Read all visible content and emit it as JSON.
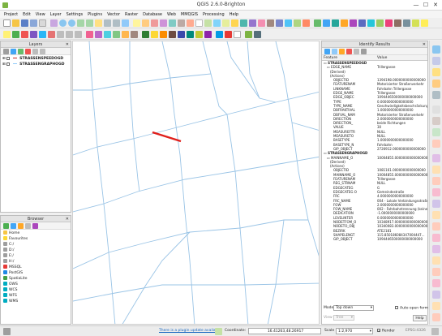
{
  "window": {
    "title": "QGIS 2.6.0-Brighton",
    "minimize": "—",
    "maximize": "☐",
    "close": "✕"
  },
  "menu": [
    "Project",
    "Edit",
    "View",
    "Layer",
    "Settings",
    "Plugins",
    "Vector",
    "Raster",
    "Database",
    "Web",
    "MMQGIS",
    "Processing",
    "Help"
  ],
  "layers": {
    "title": "Layers",
    "items": [
      {
        "label": "STRASSENSPEEDOGD",
        "color": "#c62828"
      },
      {
        "label": "STRASSENGRAPHOGD",
        "color": "#90caf9"
      }
    ]
  },
  "browser": {
    "title": "Browser",
    "items": [
      "Home",
      "Favourites",
      "C:/",
      "D:/",
      "E:/",
      "H:/",
      "MSSQL",
      "PostGIS",
      "SpatiaLite",
      "OWS",
      "WCS",
      "WFS",
      "WMS"
    ]
  },
  "identify": {
    "title": "Identify Results",
    "col_feature": "Feature",
    "col_value": "Value",
    "rows": [
      {
        "f": "▭ STRASSENSPEEDOGD",
        "v": "",
        "indent": 0
      },
      {
        "f": "▭ EDGE_NAME",
        "v": "Trillergasse",
        "indent": 1
      },
      {
        "f": "(Derived)",
        "v": "",
        "indent": 2
      },
      {
        "f": "(Actions)",
        "v": "",
        "indent": 2
      },
      {
        "f": "OBJECTID",
        "v": "1394198.0000000000000000",
        "indent": 3
      },
      {
        "f": "FEATURENAM",
        "v": "Motorisierter Straßenverkehr",
        "indent": 3
      },
      {
        "f": "LINKNAME",
        "v": "Fahrbahn Trillergasse",
        "indent": 3
      },
      {
        "f": "EDGE_NAME",
        "v": "Trillergasse",
        "indent": 3
      },
      {
        "f": "EDGE_OBJEC",
        "v": "1094446500000000000000",
        "indent": 3
      },
      {
        "f": "TYPE",
        "v": "0.0000000000000000",
        "indent": 3
      },
      {
        "f": "TYPE_NAME",
        "v": "Geschwindigkeitsbeschränkung",
        "indent": 3
      },
      {
        "f": "DBFRAKTIVAL",
        "v": "1.0000000000000000",
        "indent": 3
      },
      {
        "f": "DBFVAL_NAM",
        "v": "Motorisierter Straßenverkehr",
        "indent": 3
      },
      {
        "f": "DIRECTION",
        "v": "2.0000000000000000",
        "indent": 3
      },
      {
        "f": "DIRECTION_",
        "v": "beide Richtungen",
        "indent": 3
      },
      {
        "f": "VALUE",
        "v": "30",
        "indent": 3
      },
      {
        "f": "MEASUREFTR",
        "v": "NULL",
        "indent": 3
      },
      {
        "f": "MEASURETO",
        "v": "NULL",
        "indent": 3
      },
      {
        "f": "BASETYPE",
        "v": "1.0000000000000000",
        "indent": 3
      },
      {
        "f": "BASETYPE_N",
        "v": "Fahrbahn",
        "indent": 3
      },
      {
        "f": "GIP_OBJECT",
        "v": "2726912.0000000000000000",
        "indent": 3
      },
      {
        "f": "▭ STRASSENGRAPHOGD",
        "v": "",
        "indent": 0
      },
      {
        "f": "▭ MAINNAME_O",
        "v": "10004855.0000000000000000",
        "indent": 1
      },
      {
        "f": "(Derived)",
        "v": "",
        "indent": 2
      },
      {
        "f": "(Actions)",
        "v": "",
        "indent": 2
      },
      {
        "f": "OBJECTID",
        "v": "1081161.0000000000000000",
        "indent": 3
      },
      {
        "f": "MAINNAME_O",
        "v": "10004855.0000000000000000",
        "indent": 3
      },
      {
        "f": "FEATURENAM",
        "v": "Trillergasse",
        "indent": 3
      },
      {
        "f": "REG_STRNAM",
        "v": "NULL",
        "indent": 3
      },
      {
        "f": "EDGECATEG",
        "v": "G",
        "indent": 3
      },
      {
        "f": "EDGECATEG O",
        "v": "Gemeindestraße",
        "indent": 3
      },
      {
        "f": "FRC",
        "v": "4.0000000000000000",
        "indent": 3
      },
      {
        "f": "FRC_NAME",
        "v": "004 - Lokale Verbindungsstraße",
        "indent": 3
      },
      {
        "f": "FOW",
        "v": "2.0000000000000000",
        "indent": 3
      },
      {
        "f": "FOW_NAME",
        "v": "002 - Fahrbahntrennung (keine A...",
        "indent": 3
      },
      {
        "f": "DEDICATION",
        "v": "-1.0000000000000000",
        "indent": 3
      },
      {
        "f": "LEVELINTER",
        "v": "0.0000000000000000",
        "indent": 3
      },
      {
        "f": "NODETFOM_O",
        "v": "10348917.0000000000000000",
        "indent": 3
      },
      {
        "f": "NODETO_OBJ",
        "v": "10340083.0000000000000000",
        "indent": 3
      },
      {
        "f": "BEZIRK",
        "v": "ATE2181",
        "indent": 3
      },
      {
        "f": "SHAPELENGT",
        "v": "115.850186084347004447...",
        "indent": 3
      },
      {
        "f": "GIP_OBJECT",
        "v": "1094446500000000000000",
        "indent": 3
      }
    ],
    "mode_label": "Mode",
    "mode_value": "Top down",
    "auto_open_label": "Auto open form",
    "view_label": "View",
    "view_value": "Tree",
    "help_label": "Help"
  },
  "status": {
    "update_link": "There is a plugin update available",
    "coordinate_label": "Coordinate:",
    "coordinate_value": "16.41263,48.26917",
    "scale_label": "Scale",
    "scale_value": "1:2,970",
    "render_label": "Render",
    "crs": "EPSG:4326"
  },
  "colors": {
    "highlight": "#e0201c",
    "roads": "#9ac4e6",
    "accent": "#2e7d32"
  }
}
